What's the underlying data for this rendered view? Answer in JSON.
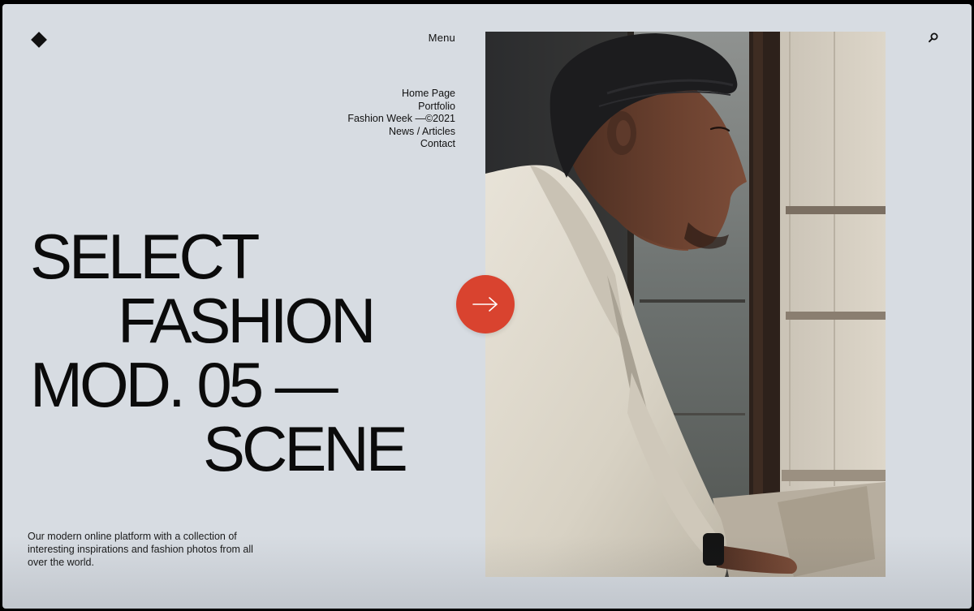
{
  "header": {
    "logo_icon": "diamond-icon",
    "menu_label": "Menu",
    "search_icon": "search-icon"
  },
  "nav": {
    "items": [
      {
        "label": "Home Page"
      },
      {
        "label": "Portfolio"
      },
      {
        "label": "Fashion Week —©2021"
      },
      {
        "label": "News / Articles"
      },
      {
        "label": "Contact"
      }
    ]
  },
  "hero": {
    "headline_lines": [
      "SELECT",
      "FASHION",
      "MOD. 05 —",
      "SCENE"
    ],
    "description": "Our modern online platform with a collection of interesting inspirations and fashion photos from all over the world.",
    "cta_icon": "arrow-right-icon"
  },
  "photo": {
    "subject": "man-in-beanie-looking-out-window"
  },
  "colors": {
    "background": "#d7dce2",
    "text": "#0e0e0e",
    "accent": "#d9432f"
  }
}
